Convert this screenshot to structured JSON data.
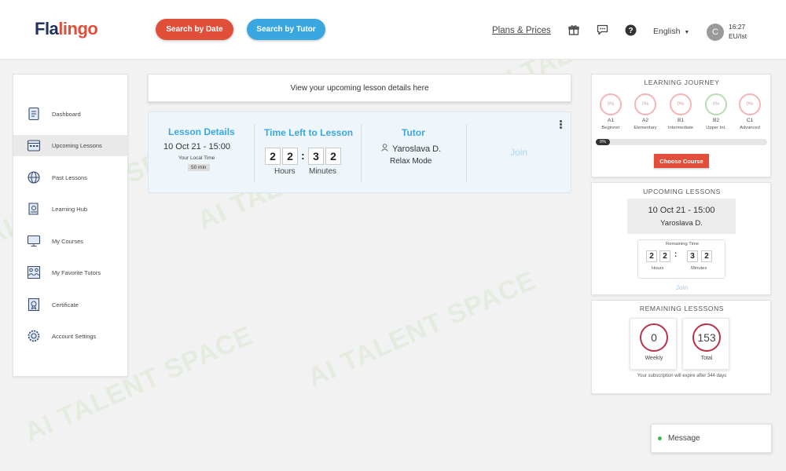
{
  "header": {
    "logo_part1": "Fla",
    "logo_part2": "lingo",
    "search_by_date": "Search by Date",
    "search_by_tutor": "Search by Tutor",
    "plans_prices": "Plans & Prices",
    "language": "English",
    "avatar_initial": "C",
    "time": "16:27",
    "timezone": "EU/Ist"
  },
  "icons": {
    "gift": "gift-icon",
    "chat": "chat-icon",
    "help": "help-icon"
  },
  "sidebar": {
    "items": [
      {
        "label": "Dashboard",
        "icon": "dashboard-icon"
      },
      {
        "label": "Upcoming Lessons",
        "icon": "calendar-icon"
      },
      {
        "label": "Past Lessons",
        "icon": "globe-icon"
      },
      {
        "label": "Learning Hub",
        "icon": "book-icon"
      },
      {
        "label": "My Courses",
        "icon": "monitor-icon"
      },
      {
        "label": "My Favorite Tutors",
        "icon": "tutors-icon"
      },
      {
        "label": "Certificate",
        "icon": "certificate-icon"
      },
      {
        "label": "Account Settings",
        "icon": "settings-icon"
      }
    ]
  },
  "main": {
    "banner": "View your upcoming lesson details here",
    "lesson": {
      "details_title": "Lesson Details",
      "datetime": "10 Oct 21 - 15:00",
      "local_time_label": "Your Local Time",
      "duration": "50 min",
      "time_left_title": "Time Left to Lesson",
      "digits": [
        "2",
        "2",
        "3",
        "2"
      ],
      "hours_label": "Hours",
      "minutes_label": "Minutes",
      "tutor_title": "Tutor",
      "tutor_name": "Yaroslava D.",
      "mode": "Relax Mode",
      "join": "Join"
    }
  },
  "journey": {
    "title": "LEARNING JOURNEY",
    "levels": [
      {
        "code": "A1",
        "name": "Beginner",
        "percent": "0%"
      },
      {
        "code": "A2",
        "name": "Elementary",
        "percent": "0%"
      },
      {
        "code": "B1",
        "name": "Intermediate",
        "percent": "0%"
      },
      {
        "code": "B2",
        "name": "Upper Int.",
        "percent": "0%"
      },
      {
        "code": "C1",
        "name": "Advanced",
        "percent": "0%"
      }
    ],
    "progress_label": "0%",
    "progress_value": 0,
    "choose_course": "Choose Course"
  },
  "upcoming": {
    "title": "UPCOMING LESSONS",
    "datetime": "10 Oct 21 - 15:00",
    "tutor": "Yaroslava D.",
    "remaining_label": "Remaining Time",
    "digits": [
      "2",
      "2",
      "3",
      "2"
    ],
    "hours_label": "Hours",
    "minutes_label": "Minutes",
    "join": "Join"
  },
  "remaining": {
    "title": "REMAINING LESSSONS",
    "weekly_value": "0",
    "weekly_label": "Weekly",
    "total_value": "153",
    "total_label": "Total",
    "expiry": "Your subscription will expire after 344 days"
  },
  "message": {
    "label": "Message"
  },
  "watermark": "AI TALENT SPACE"
}
